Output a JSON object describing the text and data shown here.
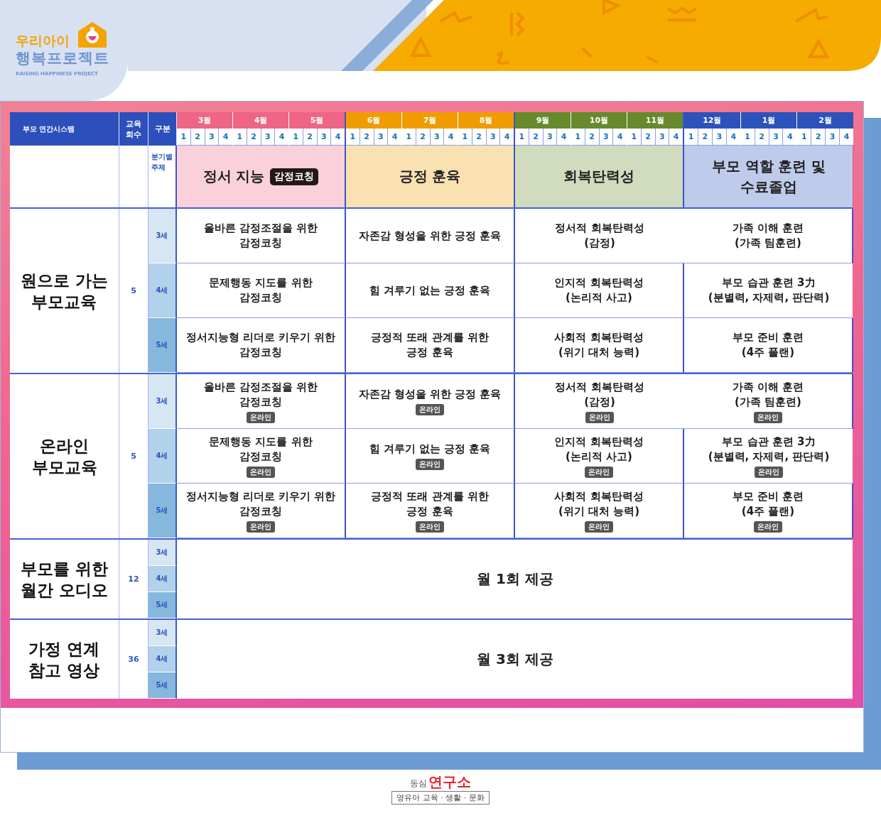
{
  "logo": {
    "line_1": "우리아이",
    "line_2": "행복프로젝트",
    "tagline": "RAISING HAPPINESS PROJECT"
  },
  "table": {
    "header": {
      "system": "부모 연간시스템",
      "count": "교육 회수",
      "division": "구분"
    },
    "theme_label": "분기별 주제",
    "quarters": [
      {
        "color": "#ee6585",
        "theme": {
          "title": "정서 지능",
          "badge": "감정코칭"
        },
        "months": [
          {
            "label": "3월",
            "weeks": [
              "1",
              "2",
              "3",
              "4"
            ]
          },
          {
            "label": "4월",
            "weeks": [
              "1",
              "2",
              "3",
              "4"
            ]
          },
          {
            "label": "5월",
            "weeks": [
              "1",
              "2",
              "3",
              "4"
            ]
          }
        ]
      },
      {
        "color": "#f09c00",
        "theme": {
          "title": "긍정 훈육"
        },
        "months": [
          {
            "label": "6월",
            "weeks": [
              "1",
              "2",
              "3",
              "4"
            ]
          },
          {
            "label": "7월",
            "weeks": [
              "1",
              "2",
              "3",
              "4"
            ]
          },
          {
            "label": "8월",
            "weeks": [
              "1",
              "2",
              "3",
              "4"
            ]
          }
        ]
      },
      {
        "color": "#668a2c",
        "theme": {
          "title": "회복탄력성"
        },
        "months": [
          {
            "label": "9월",
            "weeks": [
              "1",
              "2",
              "3",
              "4"
            ]
          },
          {
            "label": "10월",
            "weeks": [
              "1",
              "2",
              "3",
              "4"
            ]
          },
          {
            "label": "11월",
            "weeks": [
              "1",
              "2",
              "3",
              "4"
            ]
          }
        ]
      },
      {
        "color": "#2c52bb",
        "theme": {
          "title": "부모 역할 훈련 및\n수료졸업"
        },
        "months": [
          {
            "label": "12월",
            "weeks": [
              "1",
              "2",
              "3",
              "4"
            ]
          },
          {
            "label": "1월",
            "weeks": [
              "1",
              "2",
              "3",
              "4"
            ]
          },
          {
            "label": "2월",
            "weeks": [
              "1",
              "2",
              "3",
              "4"
            ]
          }
        ]
      }
    ],
    "sections": [
      {
        "kind": "courses",
        "title": "원으로 가는\n부모교육",
        "count": "5",
        "rows": [
          {
            "age": "3세",
            "cells": [
              {
                "text": "올바른 감정조절을 위한\n감정코칭"
              },
              {
                "text": "자존감 형성을 위한 긍정 훈육"
              },
              {
                "text": "정서적 회복탄력성\n(감정)"
              },
              {
                "text": "가족 이해 훈련\n(가족 팀훈련)"
              }
            ]
          },
          {
            "age": "4세",
            "cells": [
              {
                "text": "문제행동 지도를 위한\n감정코칭"
              },
              {
                "text": "힘 겨루기 없는 긍정 훈육"
              },
              {
                "text": "인지적 회복탄력성\n(논리적 사고)"
              },
              {
                "text": "부모 습관 훈련 3力\n(분별력, 자제력, 판단력)"
              }
            ]
          },
          {
            "age": "5세",
            "cells": [
              {
                "text": "정서지능형 리더로 키우기 위한\n감정코칭"
              },
              {
                "text": "긍정적 또래 관계를 위한\n긍정 훈육"
              },
              {
                "text": "사회적 회복탄력성\n(위기 대처 능력)"
              },
              {
                "text": "부모 준비 훈련\n(4주 플랜)"
              }
            ]
          }
        ]
      },
      {
        "kind": "courses",
        "title": "온라인\n부모교육",
        "count": "5",
        "rows": [
          {
            "age": "3세",
            "cells": [
              {
                "text": "올바른 감정조절을 위한\n감정코칭",
                "badge": "온라인"
              },
              {
                "text": "자존감 형성을 위한 긍정 훈육",
                "badge": "온라인"
              },
              {
                "text": "정서적 회복탄력성\n(감정)",
                "badge": "온라인"
              },
              {
                "text": "가족 이해 훈련\n(가족 팀훈련)",
                "badge": "온라인"
              }
            ]
          },
          {
            "age": "4세",
            "cells": [
              {
                "text": "문제행동 지도를 위한\n감정코칭",
                "badge": "온라인"
              },
              {
                "text": "힘 겨루기 없는 긍정 훈육",
                "badge": "온라인"
              },
              {
                "text": "인지적 회복탄력성\n(논리적 사고)",
                "badge": "온라인"
              },
              {
                "text": "부모 습관 훈련 3力\n(분별력, 자제력, 판단력)",
                "badge": "온라인"
              }
            ]
          },
          {
            "age": "5세",
            "cells": [
              {
                "text": "정서지능형 리더로 키우기 위한\n감정코칭",
                "badge": "온라인"
              },
              {
                "text": "긍정적 또래 관계를 위한\n긍정 훈육",
                "badge": "온라인"
              },
              {
                "text": "사회적 회복탄력성\n(위기 대처 능력)",
                "badge": "온라인"
              },
              {
                "text": "부모 준비 훈련\n(4주 플랜)",
                "badge": "온라인"
              }
            ]
          }
        ]
      },
      {
        "kind": "note",
        "title": "부모를 위한\n월간 오디오",
        "count": "12",
        "ages": [
          "3세",
          "4세",
          "5세"
        ],
        "note": "월 1회 제공"
      },
      {
        "kind": "note",
        "title": "가정 연계\n참고 영상",
        "count": "36",
        "ages": [
          "3세",
          "4세",
          "5세"
        ],
        "note": "월 3회 제공"
      }
    ]
  },
  "footer": {
    "brand_small": "동심",
    "brand_large": "연구소",
    "tagline": "영유아 교육 · 생활 · 문화"
  }
}
